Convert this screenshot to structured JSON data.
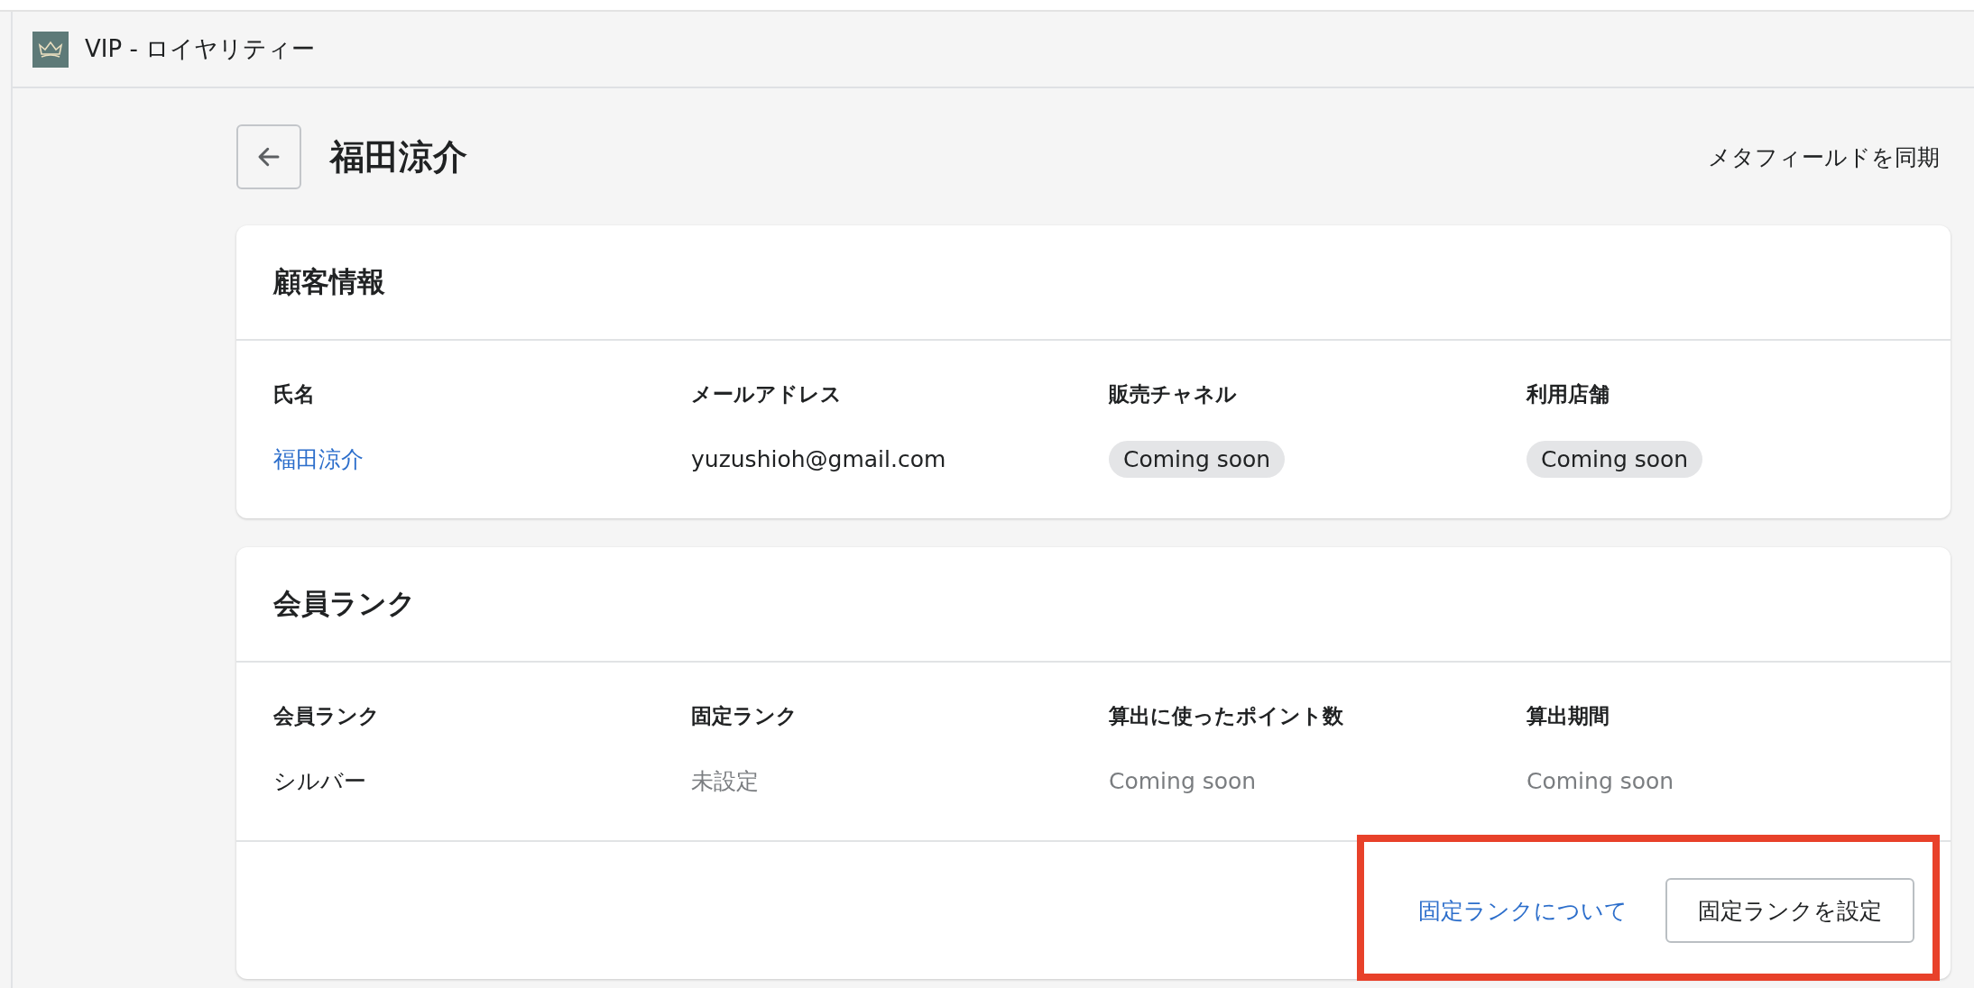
{
  "app_bar": {
    "title": "VIP - ロイヤリティー"
  },
  "page": {
    "title": "福田涼介",
    "action": "メタフィールドを同期"
  },
  "cards": [
    {
      "title": "顧客情報",
      "fields": [
        {
          "label": "氏名",
          "value": "福田涼介",
          "kind": "link"
        },
        {
          "label": "メールアドレス",
          "value": "yuzushioh@gmail.com",
          "kind": "text"
        },
        {
          "label": "販売チャネル",
          "value": "Coming soon",
          "kind": "badge"
        },
        {
          "label": "利用店舗",
          "value": "Coming soon",
          "kind": "badge"
        }
      ]
    },
    {
      "title": "会員ランク",
      "fields": [
        {
          "label": "会員ランク",
          "value": "シルバー",
          "kind": "text"
        },
        {
          "label": "固定ランク",
          "value": "未設定",
          "kind": "muted"
        },
        {
          "label": "算出に使ったポイント数",
          "value": "Coming soon",
          "kind": "muted"
        },
        {
          "label": "算出期間",
          "value": "Coming soon",
          "kind": "muted"
        }
      ],
      "footer": {
        "link": "固定ランクについて",
        "button": "固定ランクを設定",
        "highlighted": true
      }
    }
  ]
}
